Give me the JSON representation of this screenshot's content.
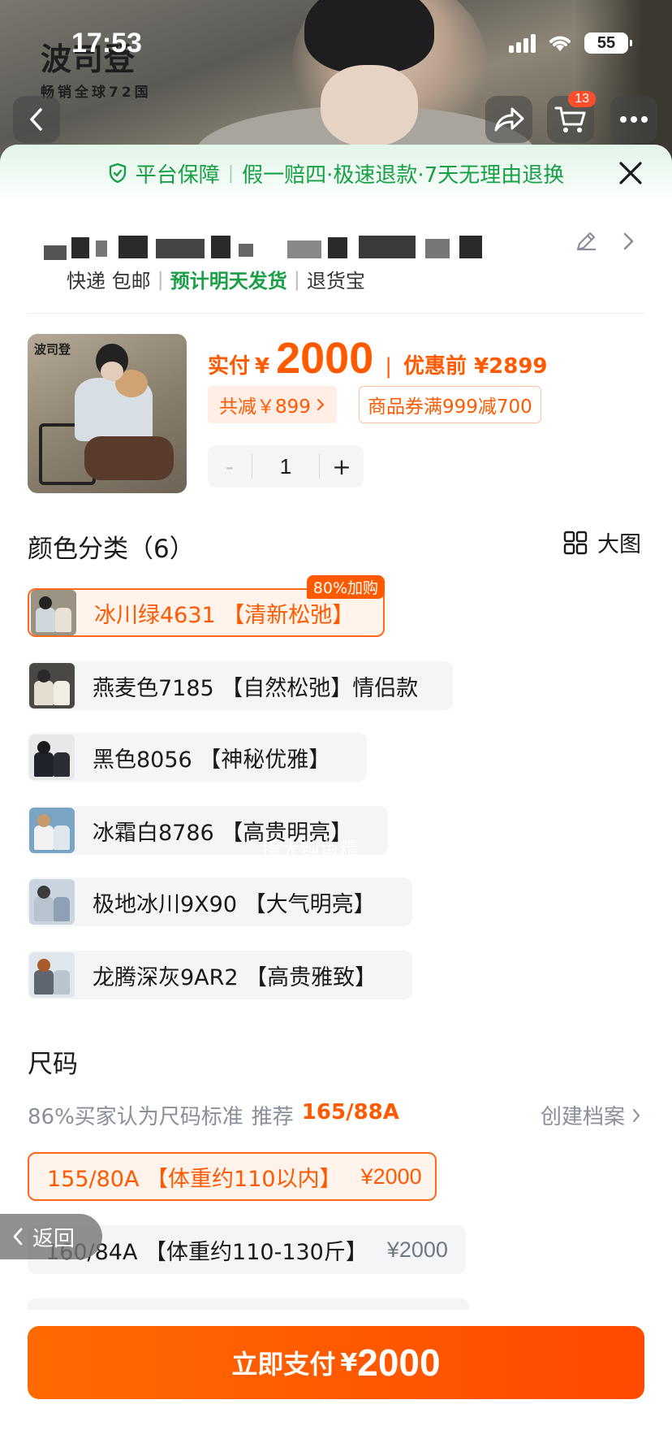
{
  "status_bar": {
    "time": "17:53",
    "battery": "55"
  },
  "hero": {
    "brand_logo": "波司登",
    "brand_slogan": "畅销全球72国",
    "cart_count": "13"
  },
  "guarantee": {
    "title": "平台保障",
    "separator": "|",
    "items": "假一赔四·极速退款·7天无理由退换"
  },
  "shipping": {
    "express": "快递 包邮",
    "delivery": "预计明天发货",
    "refund": "退货宝",
    "sep": "|"
  },
  "price": {
    "pay_label": "实付",
    "currency": "¥",
    "amount": "2000",
    "sep": "|",
    "original_label": "优惠前 ¥2899",
    "discount_tag": "共减￥899",
    "coupon_tag": "商品券满999减700",
    "quantity": "1",
    "minus": "-",
    "plus": "+"
  },
  "color_section": {
    "title": "颜色分类（6）",
    "big_image_label": "大图",
    "selected_badge": "80%加购",
    "options": [
      {
        "label": "冰川绿4631 【清新松弛】",
        "selected": true,
        "head": "#222222",
        "body": "#cfd7dc",
        "body2": "#e8e2d6",
        "bg": "#9a9283"
      },
      {
        "label": "燕麦色7185 【自然松弛】情侣款",
        "selected": false,
        "head": "#2a2a2a",
        "body": "#e3ddd0",
        "body2": "#f2ede4",
        "bg": "#4a4844"
      },
      {
        "label": "黑色8056 【神秘优雅】",
        "selected": false,
        "head": "#1b1b1b",
        "body": "#1f232b",
        "body2": "#2a2d33",
        "bg": "#e8e8e8"
      },
      {
        "label": "冰霜白8786 【高贵明亮】",
        "selected": false,
        "head": "#c89a6a",
        "body": "#f2f2f2",
        "body2": "#dfe6ee",
        "bg": "#7aa4c4"
      },
      {
        "label": "极地冰川9X90 【大气明亮】",
        "selected": false,
        "head": "#3a3a3a",
        "body": "#b7c3cf",
        "body2": "#8ea0b3",
        "bg": "#c9d4de"
      },
      {
        "label": "龙腾深灰9AR2 【高贵雅致】",
        "selected": false,
        "head": "#a85a2a",
        "body": "#5f6670",
        "body2": "#b9c4cf",
        "bg": "#dfe6ec"
      }
    ]
  },
  "watermark": "搜大纯鱼精",
  "size_section": {
    "title": "尺码",
    "tip": "86%买家认为尺码标准",
    "recommend_label": "推荐",
    "recommend_value": "165/88A",
    "profile_link": "创建档案",
    "options": [
      {
        "label": "155/80A 【体重约110以内】",
        "price": "¥2000",
        "selected": true
      },
      {
        "label": "160/84A 【体重约110-130斤】",
        "price": "¥2000",
        "selected": false
      }
    ]
  },
  "back_label": "返回",
  "pay_button": {
    "label": "立即支付",
    "currency": "¥",
    "amount": "2000"
  }
}
